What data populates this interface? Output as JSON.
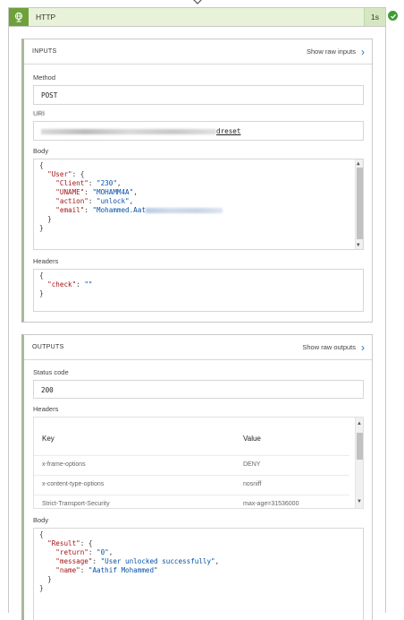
{
  "card": {
    "title": "HTTP",
    "duration": "1s",
    "icon": "globe-icon",
    "status": "succeeded",
    "accent_color": "#6ea13b",
    "badge_color": "#3f9c35"
  },
  "inputs": {
    "section_title": "INPUTS",
    "raw_link": "Show raw inputs",
    "method_label": "Method",
    "method_value": "POST",
    "uri_label": "URI",
    "uri_visible_suffix": "dreset",
    "body_label": "Body",
    "body_lines": [
      {
        "indent": 0,
        "text": "{"
      },
      {
        "indent": 1,
        "key": "\"User\"",
        "rest": ": {"
      },
      {
        "indent": 2,
        "key": "\"Client\"",
        "value": "\"230\"",
        "end": ","
      },
      {
        "indent": 2,
        "key": "\"UNAME\"",
        "value": "\"MOHAMM4A\"",
        "end": ","
      },
      {
        "indent": 2,
        "key": "\"action\"",
        "value": "\"unlock\"",
        "end": ","
      },
      {
        "indent": 2,
        "key": "\"email\"",
        "value": "\"Mohammed.Aat",
        "redacted": true
      },
      {
        "indent": 1,
        "text": "}"
      },
      {
        "indent": 0,
        "text": "}"
      }
    ],
    "headers_label": "Headers",
    "headers_lines": [
      {
        "indent": 0,
        "text": "{"
      },
      {
        "indent": 1,
        "key": "\"check\"",
        "value": "\"\""
      },
      {
        "indent": 0,
        "text": "}"
      }
    ]
  },
  "outputs": {
    "section_title": "OUTPUTS",
    "raw_link": "Show raw outputs",
    "status_label": "Status code",
    "status_value": "200",
    "headers_label": "Headers",
    "table_columns": [
      "Key",
      "Value"
    ],
    "table_rows": [
      {
        "key": "x-frame-options",
        "value": "DENY"
      },
      {
        "key": "x-content-type-options",
        "value": "nosniff"
      },
      {
        "key": "Strict-Transport-Security",
        "value": "max-age=31536000"
      }
    ],
    "body_label": "Body",
    "body_lines": [
      {
        "indent": 0,
        "text": "{"
      },
      {
        "indent": 1,
        "key": "\"Result\"",
        "rest": ": {"
      },
      {
        "indent": 2,
        "key": "\"return\"",
        "value": "\"0\"",
        "end": ","
      },
      {
        "indent": 2,
        "key": "\"message\"",
        "value": "\"User unlocked successfully\"",
        "end": ","
      },
      {
        "indent": 2,
        "key": "\"name\"",
        "value": "\"Aathif Mohammed\""
      },
      {
        "indent": 1,
        "text": "}"
      },
      {
        "indent": 0,
        "text": "}"
      }
    ]
  }
}
